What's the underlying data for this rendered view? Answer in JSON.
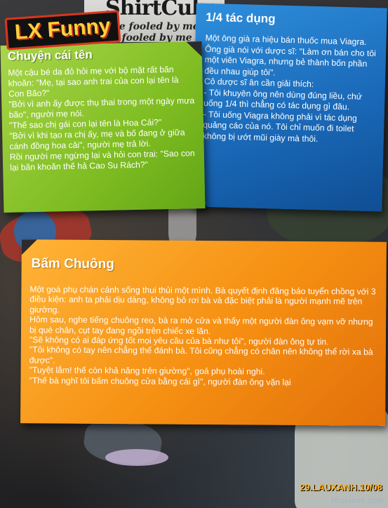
{
  "header": {
    "logo": "LX Funny",
    "shirt_brand": "ShirtCube",
    "shirt_lines": [
      "be fooled by me",
      "be fooled by me"
    ]
  },
  "notes": [
    {
      "color": "#7fbd22",
      "title": "Chuyện cái tên",
      "paragraphs": [
        "Một cậu bé da đỏ hỏi mẹ với bộ mặt rất băn khoăn: \"Mẹ, tại sao anh trai của con lại tên là Con Bão?\"",
        "\"Bởi vì anh ấy được thụ thai trong một ngày mưa bão\", người mẹ nói.",
        "\"Thế sao chị gái con lại tên là Hoa Cải?\"",
        "\"Bởi vì khi tạo ra chị ấy, mẹ và bố đang ở giữa cánh đồng hoa cải\", người mẹ trả lời.",
        "Rồi người mẹ ngừng lại và hỏi con trai: \"Sao con lại băn khoăn thế hả Cao Su Rách?\""
      ]
    },
    {
      "color": "#1a69b8",
      "title": "1/4 tác dụng",
      "paragraphs": [
        "Một ông già ra hiệu bán thuốc mua Viagra. Ông già nói với dược sĩ: \"Làm ơn bán cho tôi một viên Viagra, nhưng bẻ thành bốn phần đều nhau giúp tôi\".",
        "Cô dược sĩ ân cần giải thích:",
        "- Tôi khuyên ông nên dùng đúng liều, chứ uống 1/4 thì chẳng có tác dụng gì đâu.",
        "- Tôi uống Viagra không phải vì tác dụng quảng cáo của nó. Tôi chỉ muốn đi toilet không bị ướt mũi giày mà thôi."
      ]
    },
    {
      "color": "#f58f12",
      "title": "Bấm Chuông",
      "paragraphs": [
        "Một goá phụ chán cảnh sống thui thủi một mình. Bà quyết định đăng báo tuyển chồng với 3 điều kiện: anh ta phải dịu dàng, không bỏ rơi bà và đặc biệt phải là người mạnh mẽ trên giường.",
        "Hôm sau, nghe tiếng chuông reo, bà ra mở cửa và thấy một người đàn ông vạm vỡ nhưng bị què chân, cụt tay đang ngồi trên chiếc xe lăn.",
        "\"Sẽ không có ai đáp ứng tốt mọi yêu cầu của bà như tôi\", người đàn ông tự tin.",
        "\"Tôi không có tay nên chẳng thể đánh bà. Tôi cũng chẳng có chân nên không thể rời xa bà được\".",
        "\"Tuyệt lắm! thế còn khả năng trên giường\", goá phụ hoài nghi.",
        "\"Thế bà nghĩ tôi bấm chuông cửa bằng cái gì\", người đàn ông vặn lại"
      ]
    }
  ],
  "footer": {
    "issue": "29.LAUXANH.10/08",
    "watermark": "thuvienx.com"
  }
}
